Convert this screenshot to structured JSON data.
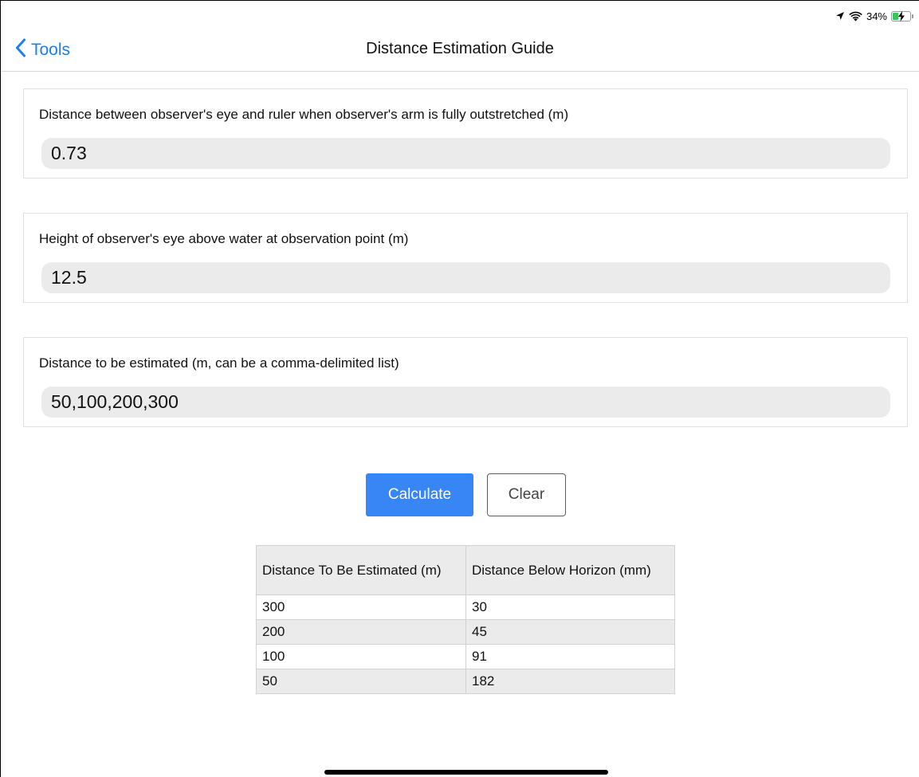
{
  "status_bar": {
    "battery_text": "34%",
    "battery_level": 0.34,
    "icons": [
      "location-arrow-icon",
      "wifi-icon",
      "battery-charging-icon"
    ]
  },
  "nav": {
    "back_label": "Tools",
    "title": "Distance Estimation Guide"
  },
  "form": {
    "fields": [
      {
        "label": "Distance between observer's eye and ruler when observer's arm is fully outstretched (m)",
        "value": "0.73"
      },
      {
        "label": "Height of observer's eye above water at observation point (m)",
        "value": "12.5"
      },
      {
        "label": "Distance to be estimated (m, can be a comma-delimited list)",
        "value": "50,100,200,300"
      }
    ]
  },
  "buttons": {
    "calculate_label": "Calculate",
    "clear_label": "Clear"
  },
  "results": {
    "columns": [
      "Distance To Be Estimated (m)",
      "Distance Below Horizon (mm)"
    ],
    "rows": [
      [
        "300",
        "30"
      ],
      [
        "200",
        "45"
      ],
      [
        "100",
        "91"
      ],
      [
        "50",
        "182"
      ]
    ]
  },
  "colors": {
    "accent": "#1a7ef5",
    "button_primary": "#3886f6",
    "input_background": "#ebebeb",
    "battery_fill": "#34c759"
  }
}
